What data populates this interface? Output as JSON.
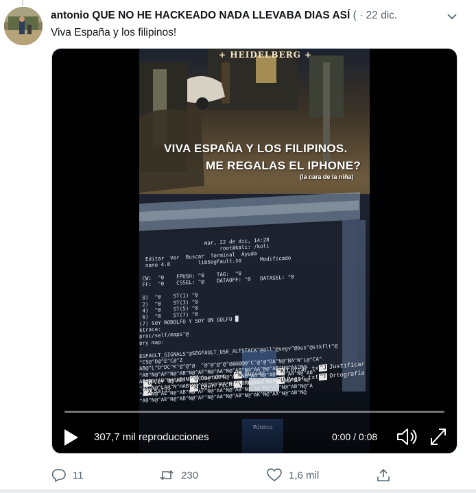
{
  "tweet": {
    "author_name": "antonio QUE NO HE HACKEADO NADA LLEVABA DIAS ASÍ",
    "author_meta": " ( · 22 dic.",
    "text": "Viva España y los filipinos!"
  },
  "video": {
    "sign_text": "+ HEIDELBERG +",
    "overlay_line1": "VIVA ESPAÑA Y LOS FILIPINOS.",
    "overlay_line2": "ME REGALAS EL IPHONE?",
    "overlay_note": "(la cara de la niña)",
    "terminal_lines": [
      "                     mar, 22 de dic, 14:28",
      "                          root@kali: /koli",
      "  Editar  Ver  Buscar  Terminal  Ayuda",
      "  nano 4.8         libSegFault.so      Modificado",
      "",
      " CW:  ^0    FPUSH: ^0    TAG:  ^0",
      " FF:  ^0    CSSEL: ^@    DATAOFF: ^0   DATASEL: ^0",
      "",
      " 0)  ^0    ST(1) ^0",
      " 2)  ^0    ST(3) ^0",
      " 4)  ^0    ST(5) ^0",
      " 6)  ^0    ST(7) ^0",
      "(7) SOY RODOLFO Y SOY UN GOLFO █",
      "ktrace:",
      "proc/self/maps^@",
      "ory map:",
      "",
      "EGFAULT_SIGNALS^@SEGFAULT_USE_ALTSTACK^@all^@segv^@bus^@stkflt^@",
      "^CS@^D@^E^C@^Z",
      "AB@^L^D^DC^K^@^@^@  ^@^@^@^@^@@@@@@^C^@^@^DA^N@^BA^N^L@^CA^",
      "^AB^N@^AF^N@^AB^N@^AF^N@^AA^N@^AB^N@^AA^N@^AB^N@^AA^N@",
      "AB^N@^AB^N@^AD^N@^AC^N@^AA^N@^AG^N@^AA^N@^AB^N@^AA^N@^AB^",
      "^AB^N@^LA@^N^HAB^N@^AB^N@^AA^N@^AB^N@^AA^N@^AB^N@^AA^N@",
      "^AB^N@^AE^N@^AB^N@^AF^N@^AA^N@^AB^N@^AA^N@^AB^N@^AB^N@^A",
      "^AB^N@^AE^N@^AB^N@^AF^N@^AA^N@^AB^N@^AK^N@^AA^N@^AB^N@"
    ],
    "nano_menu": [
      {
        "key": "^G",
        "label": "Ver ayuda"
      },
      {
        "key": "^O",
        "label": "Guardar"
      },
      {
        "key": "^W",
        "label": "Buscar"
      },
      {
        "key": "^K",
        "label": "Cortar txt"
      },
      {
        "key": "^J",
        "label": "Justificar"
      },
      {
        "key": "^X",
        "label": "Salir"
      },
      {
        "key": "^R",
        "label": "Leer fich."
      },
      {
        "key": "^\\",
        "label": "Reemplazar"
      },
      {
        "key": "^U",
        "label": "Pegar txt"
      },
      {
        "key": "^T",
        "label": "Ortografía"
      }
    ],
    "desktop_label": "Público",
    "views": "307,7 mil reproducciones",
    "time": "0:00 / 0:08",
    "progress": 0.0
  },
  "actions": {
    "replies": "11",
    "retweets": "230",
    "likes": "1,6 mil"
  },
  "icons": {
    "caret": "chevron-down-icon",
    "play": "play-icon",
    "volume": "volume-muted-icon",
    "fullscreen": "fullscreen-icon",
    "reply": "reply-icon",
    "retweet": "retweet-icon",
    "like": "heart-icon",
    "share": "share-icon"
  },
  "colors": {
    "text": "#0f1419",
    "secondary": "#536471",
    "border": "#cfd9de"
  }
}
